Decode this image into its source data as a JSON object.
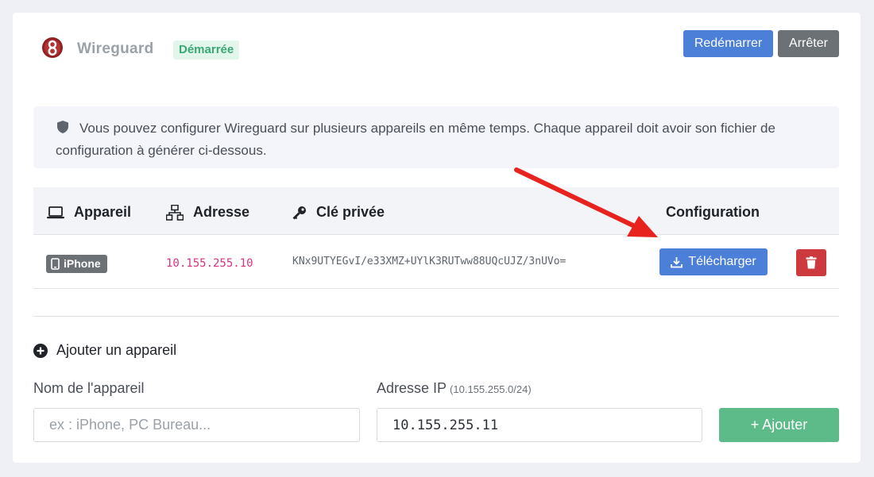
{
  "header": {
    "title": "Wireguard",
    "status_badge": "Démarrée",
    "restart_label": "Redémarrer",
    "stop_label": "Arrêter"
  },
  "notice": {
    "text": "Vous pouvez configurer Wireguard sur plusieurs appareils en même temps. Chaque appareil doit avoir son fichier de configuration à générer ci-dessous."
  },
  "table": {
    "columns": [
      "Appareil",
      "Adresse",
      "Clé privée",
      "Configuration"
    ],
    "rows": [
      {
        "device": "iPhone",
        "address": "10.155.255.10",
        "private_key": "KNx9UTYEGvI/e33XMZ+UYlK3RUTww88UQcUJZ/3nUVo=",
        "download_label": "Télécharger"
      }
    ]
  },
  "add_device": {
    "title": "Ajouter un appareil",
    "name_label": "Nom de l'appareil",
    "name_placeholder": "ex : iPhone, PC Bureau...",
    "ip_label": "Adresse IP",
    "ip_hint": "(10.155.255.0/24)",
    "ip_value": "10.155.255.11",
    "add_label": "+ Ajouter"
  },
  "colors": {
    "primary": "#4b7fd8",
    "secondary": "#6c7176",
    "danger": "#cc3a3d",
    "success": "#5dbb8a",
    "annotation_arrow": "#e8231f"
  }
}
